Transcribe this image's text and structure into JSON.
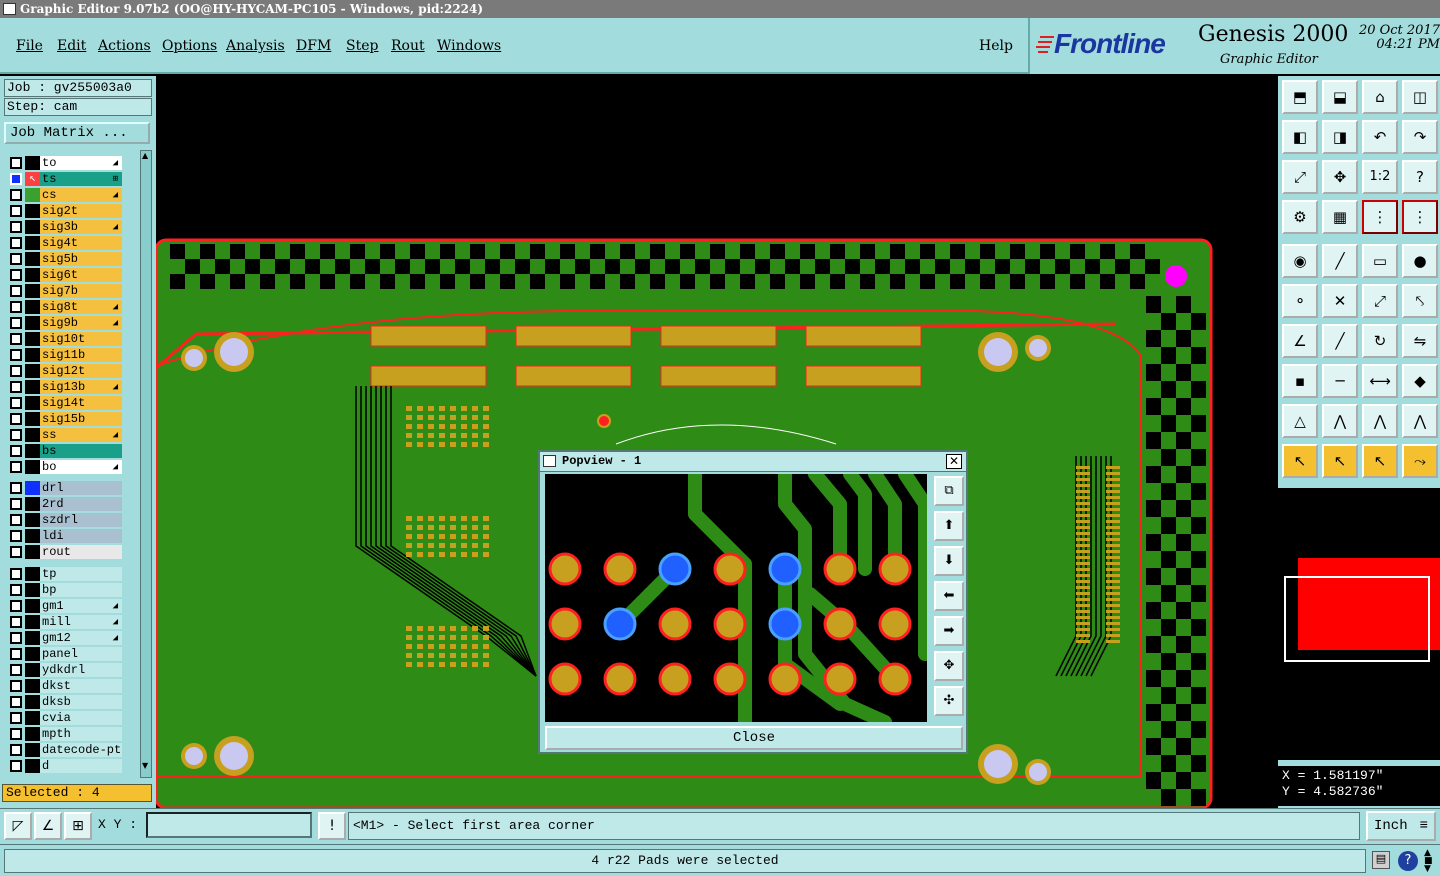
{
  "window": {
    "title": "Graphic Editor 9.07b2 (OO@HY-HYCAM-PC105 - Windows, pid:2224)"
  },
  "menu": {
    "items": [
      "File",
      "Edit",
      "Actions",
      "Options",
      "Analysis",
      "DFM",
      "Step",
      "Rout",
      "Windows"
    ],
    "help": "Help"
  },
  "brand": {
    "logo": "Frontline",
    "product": "Genesis 2000",
    "subtitle": "Graphic Editor",
    "date": "20 Oct 2017",
    "time": "04:21 PM"
  },
  "job": {
    "job_label": "Job : gv255003a0",
    "step_label": "Step: cam",
    "matrix_button": "Job Matrix ..."
  },
  "layers": {
    "group1": [
      {
        "name": "to",
        "color": "#ffffff",
        "swatch": "#000000",
        "mark": "◢"
      },
      {
        "name": "ts",
        "color": "#1aa088",
        "swatch": "#ff4040",
        "mark": "⊞",
        "selected": true
      },
      {
        "name": "cs",
        "color": "#f5c040",
        "swatch": "#3aa030",
        "mark": "◢"
      },
      {
        "name": "sig2t",
        "color": "#f5c040",
        "swatch": "#000000",
        "mark": ""
      },
      {
        "name": "sig3b",
        "color": "#f5c040",
        "swatch": "#000000",
        "mark": "◢"
      },
      {
        "name": "sig4t",
        "color": "#f5c040",
        "swatch": "#000000",
        "mark": ""
      },
      {
        "name": "sig5b",
        "color": "#f5c040",
        "swatch": "#000000",
        "mark": ""
      },
      {
        "name": "sig6t",
        "color": "#f5c040",
        "swatch": "#000000",
        "mark": ""
      },
      {
        "name": "sig7b",
        "color": "#f5c040",
        "swatch": "#000000",
        "mark": ""
      },
      {
        "name": "sig8t",
        "color": "#f5c040",
        "swatch": "#000000",
        "mark": "◢"
      },
      {
        "name": "sig9b",
        "color": "#f5c040",
        "swatch": "#000000",
        "mark": "◢"
      },
      {
        "name": "sig10t",
        "color": "#f5c040",
        "swatch": "#000000",
        "mark": ""
      },
      {
        "name": "sig11b",
        "color": "#f5c040",
        "swatch": "#000000",
        "mark": ""
      },
      {
        "name": "sig12t",
        "color": "#f5c040",
        "swatch": "#000000",
        "mark": ""
      },
      {
        "name": "sig13b",
        "color": "#f5c040",
        "swatch": "#000000",
        "mark": "◢"
      },
      {
        "name": "sig14t",
        "color": "#f5c040",
        "swatch": "#000000",
        "mark": ""
      },
      {
        "name": "sig15b",
        "color": "#f5c040",
        "swatch": "#000000",
        "mark": ""
      },
      {
        "name": "ss",
        "color": "#f5c040",
        "swatch": "#000000",
        "mark": "◢"
      },
      {
        "name": "bs",
        "color": "#1aa088",
        "swatch": "#000000",
        "mark": ""
      },
      {
        "name": "bo",
        "color": "#ffffff",
        "swatch": "#000000",
        "mark": "◢"
      }
    ],
    "group2": [
      {
        "name": "drl",
        "color": "#a8c0d0",
        "swatch": "#1030ff",
        "mark": ""
      },
      {
        "name": "2rd",
        "color": "#a8c0d0",
        "swatch": "#000000",
        "mark": ""
      },
      {
        "name": "szdrl",
        "color": "#a8c0d0",
        "swatch": "#000000",
        "mark": ""
      },
      {
        "name": "ldi",
        "color": "#a8c0d0",
        "swatch": "#000000",
        "mark": ""
      },
      {
        "name": "rout",
        "color": "#e8e8e8",
        "swatch": "#000000",
        "mark": ""
      }
    ],
    "group3": [
      {
        "name": "tp",
        "color": "#bfe8e8",
        "swatch": "#000000",
        "mark": ""
      },
      {
        "name": "bp",
        "color": "#bfe8e8",
        "swatch": "#000000",
        "mark": ""
      },
      {
        "name": "gm1",
        "color": "#bfe8e8",
        "swatch": "#000000",
        "mark": "◢"
      },
      {
        "name": "mill",
        "color": "#bfe8e8",
        "swatch": "#000000",
        "mark": "◢"
      },
      {
        "name": "gm12",
        "color": "#bfe8e8",
        "swatch": "#000000",
        "mark": "◢"
      },
      {
        "name": "panel",
        "color": "#bfe8e8",
        "swatch": "#000000",
        "mark": ""
      },
      {
        "name": "ydkdrl",
        "color": "#bfe8e8",
        "swatch": "#000000",
        "mark": ""
      },
      {
        "name": "dkst",
        "color": "#bfe8e8",
        "swatch": "#000000",
        "mark": ""
      },
      {
        "name": "dksb",
        "color": "#bfe8e8",
        "swatch": "#000000",
        "mark": ""
      },
      {
        "name": "cvia",
        "color": "#bfe8e8",
        "swatch": "#000000",
        "mark": ""
      },
      {
        "name": "mpth",
        "color": "#bfe8e8",
        "swatch": "#000000",
        "mark": ""
      },
      {
        "name": "datecode-pt",
        "color": "#bfe8e8",
        "swatch": "#000000",
        "mark": ""
      },
      {
        "name": "d",
        "color": "#bfe8e8",
        "swatch": "#000000",
        "mark": ""
      }
    ]
  },
  "selection": {
    "text": "Selected : 4"
  },
  "toolbar_icons": [
    "home-icon",
    "open-icon",
    "house-icon",
    "window-icon",
    "back-icon",
    "forward-icon",
    "undo-icon",
    "redo-icon",
    "zoom-fit-icon",
    "zoom-center-icon",
    "scale-icon",
    "help-icon",
    "filter-icon",
    "grid-icon",
    "snap-icon",
    "snap2-icon",
    "select-icon",
    "line-icon",
    "measure-icon",
    "circle-icon",
    "node-icon",
    "cross-icon",
    "add-node-icon",
    "add-node2-icon",
    "angle-icon",
    "slash-icon",
    "rotate-icon",
    "flip-icon",
    "feature-icon",
    "minus-icon",
    "resize-icon",
    "shapes-icon",
    "triangle-icon",
    "arch-icon",
    "arch2-icon",
    "arch3-icon",
    "pointer-icon",
    "pointer2-icon",
    "pointer3-icon",
    "connect-icon"
  ],
  "scale_label": "1:2",
  "coords": {
    "x": "X = 1.581197\"",
    "y": "Y = 4.582736\""
  },
  "bottom": {
    "xy_label": "X Y :",
    "xy_value": "",
    "prompt": "<M1> - Select first area corner",
    "units": "Inch"
  },
  "status": {
    "message": "4 r22 Pads were selected"
  },
  "popview": {
    "title": "Popview - 1",
    "close_label": "Close"
  },
  "colors": {
    "board": "#2e8b16",
    "copper": "#c8a020",
    "outline": "#ff2020",
    "panel": "#a3dcdc",
    "highlight": "#2060ff"
  }
}
